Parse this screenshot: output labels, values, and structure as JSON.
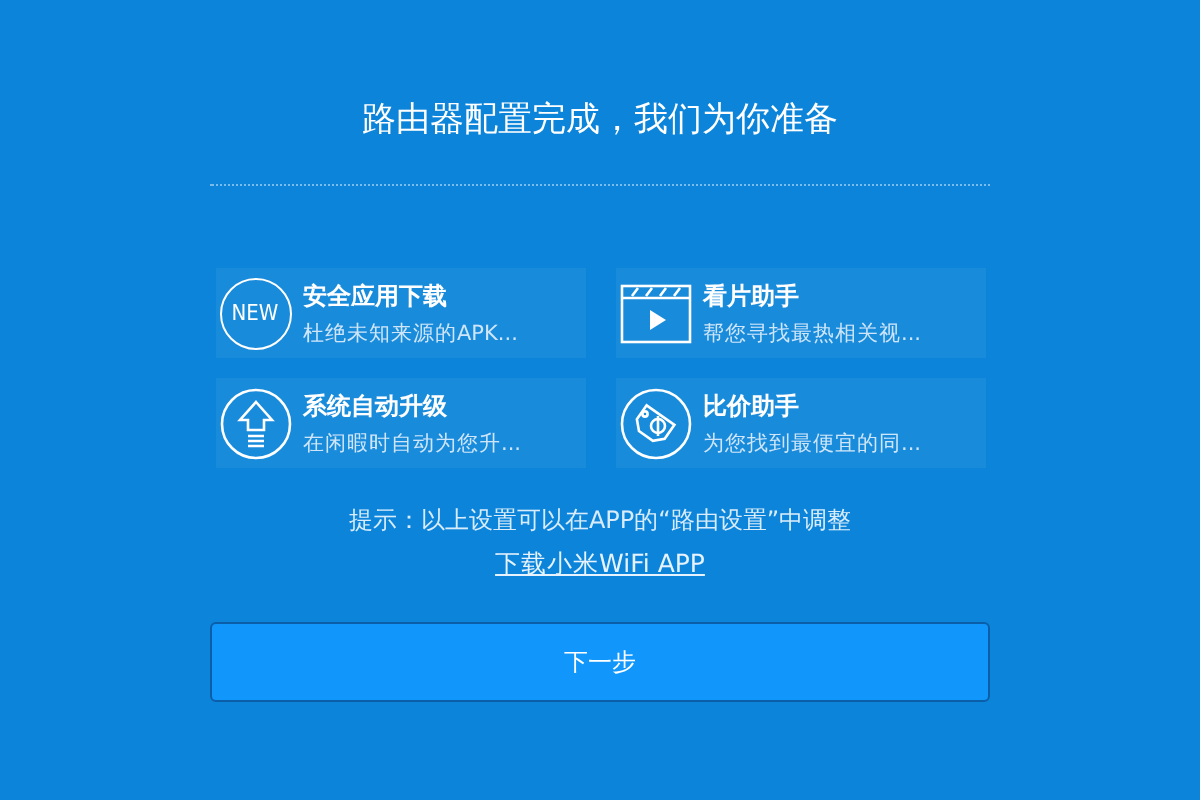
{
  "title": "路由器配置完成，我们为你准备",
  "features": [
    {
      "kind": "new",
      "icon_text": "NEW",
      "name": "安全应用下载",
      "desc": "杜绝未知来源的APK..."
    },
    {
      "kind": "video",
      "name": "看片助手",
      "desc": "帮您寻找最热相关视..."
    },
    {
      "kind": "upgrade",
      "name": "系统自动升级",
      "desc": "在闲暇时自动为您升..."
    },
    {
      "kind": "price",
      "name": "比价助手",
      "desc": "为您找到最便宜的同..."
    }
  ],
  "tip": "提示：以上设置可以在APP的“路由设置”中调整",
  "link": "下载小米WiFi APP",
  "next_button": "下一步"
}
